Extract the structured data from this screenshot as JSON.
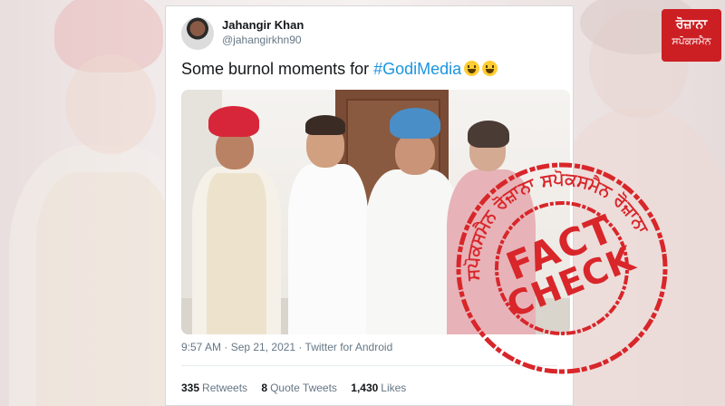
{
  "tweet": {
    "author_name": "Jahangir Khan",
    "author_handle": "@jahangirkhn90",
    "text_prefix": "Some burnol moments for ",
    "hashtag": "#GodiMedia",
    "timestamp": "9:57 AM · Sep 21, 2021 · Twitter for Android",
    "retweets_count": "335",
    "retweets_label": "Retweets",
    "quote_count": "8",
    "quote_label": "Quote Tweets",
    "likes_count": "1,430",
    "likes_label": "Likes"
  },
  "logo": {
    "line1": "ਰੋਜ਼ਾਨਾ",
    "line2": "ਸਪੋਕਸਮੈਨ"
  },
  "stamp": {
    "word1": "FACT",
    "word2": "CHECK",
    "ring_text": "ਸਪੋਕਸਮੈਨ ਰੋਜ਼ਾਨਾ ਸਪੋਕਸਮੈਨ ਰੋਜ਼ਾਨਾ"
  },
  "colors": {
    "hashtag": "#1b95e0",
    "stamp_red": "#d8262a",
    "logo_red": "#cc1f24"
  },
  "icons": {
    "emoji": "grinning-face-emoji"
  }
}
